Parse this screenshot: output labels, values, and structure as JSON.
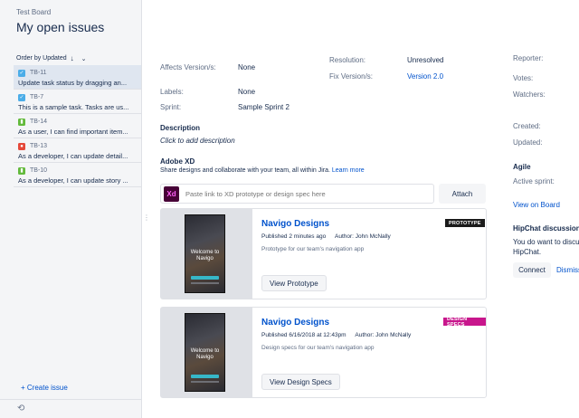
{
  "header": {
    "project": "Test Board",
    "title": "My open issues"
  },
  "sidebar": {
    "order_label": "Order by Updated",
    "order_arrow": "↓",
    "order_chevron": "⌄",
    "issues": [
      {
        "key": "TB-11",
        "type": "task",
        "summary": "Update task status by dragging an...",
        "active": true
      },
      {
        "key": "TB-7",
        "type": "task",
        "summary": "This is a sample task. Tasks are us...",
        "active": false
      },
      {
        "key": "TB-14",
        "type": "story",
        "summary": "As a user, I can find important item...",
        "active": false
      },
      {
        "key": "TB-13",
        "type": "bug",
        "summary": "As a developer, I can update detail...",
        "active": false
      },
      {
        "key": "TB-10",
        "type": "story",
        "summary": "As a developer, I can update story ...",
        "active": false
      }
    ],
    "create_issue": "+ Create issue",
    "refresh_glyph": "⟲",
    "resize_glyph": "⋮"
  },
  "details": {
    "affects_label": "Affects Version/s:",
    "affects_value": "None",
    "labels_label": "Labels:",
    "labels_value": "None",
    "sprint_label": "Sprint:",
    "sprint_value": "Sample Sprint 2",
    "resolution_label": "Resolution:",
    "resolution_value": "Unresolved",
    "fix_label": "Fix Version/s:",
    "fix_value": "Version 2.0"
  },
  "people": {
    "reporter_label": "Reporter:",
    "votes_label": "Votes:",
    "watchers_label": "Watchers:",
    "created_label": "Created:",
    "updated_label": "Updated:"
  },
  "agile": {
    "title": "Agile",
    "active_sprint_label": "Active sprint:",
    "view_board": "View on Board"
  },
  "hipchat": {
    "title": "HipChat discussions",
    "text_line1": "You do want to discu",
    "text_line2": "HipChat.",
    "connect": "Connect",
    "dismiss": "Dismiss"
  },
  "description": {
    "title": "Description",
    "placeholder": "Click to add description"
  },
  "adobe_xd": {
    "title": "Adobe XD",
    "note": "Share designs and collaborate with your team, all within Jira.",
    "learn_more": "Learn more",
    "logo": "Xd",
    "input_placeholder": "Paste link to XD prototype or design spec here",
    "attach": "Attach"
  },
  "cards": [
    {
      "name": "Navigo Designs",
      "badge": "PROTOTYPE",
      "badge_color": "#1b1b1b",
      "published": "Published 2 minutes ago",
      "author": "Author: John McNally",
      "description": "Prototype for our team's navigation app",
      "button": "View Prototype",
      "thumb_text": "Welcome to Navigo"
    },
    {
      "name": "Navigo Designs",
      "badge": "DESIGN SPECS",
      "badge_color": "#c8168c",
      "published": "Published 6/16/2018 at 12:43pm",
      "author": "Author: John McNally",
      "description": "Design specs for our team's navigation app",
      "button": "View Design Specs",
      "thumb_text": "Welcome to Navigo"
    }
  ]
}
